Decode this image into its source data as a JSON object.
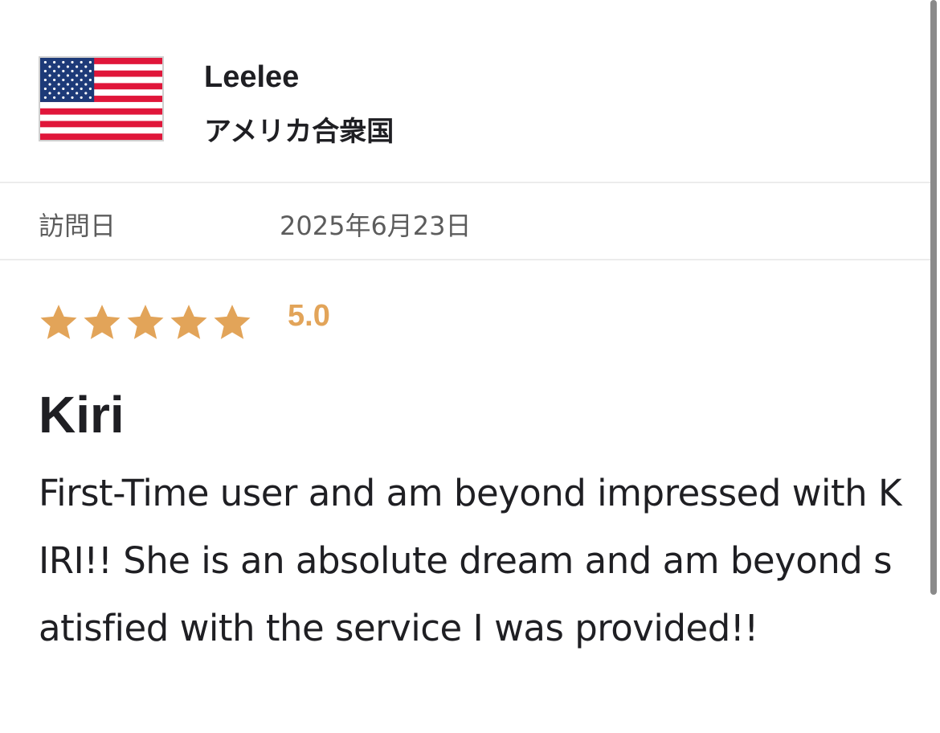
{
  "reviewer": {
    "flag_icon": "us-flag-icon",
    "name": "Leelee",
    "country": "アメリカ合衆国"
  },
  "visit": {
    "label": "訪問日",
    "date": "2025年6月23日"
  },
  "rating": {
    "stars": 5,
    "max_stars": 5,
    "value": "5.0",
    "star_color": "#e2a459"
  },
  "review": {
    "title": "Kiri",
    "body": "First-Time user and am beyond impressed with KIRI!! She is an absolute dream and am beyond satisfied with the service I was provided!!"
  }
}
